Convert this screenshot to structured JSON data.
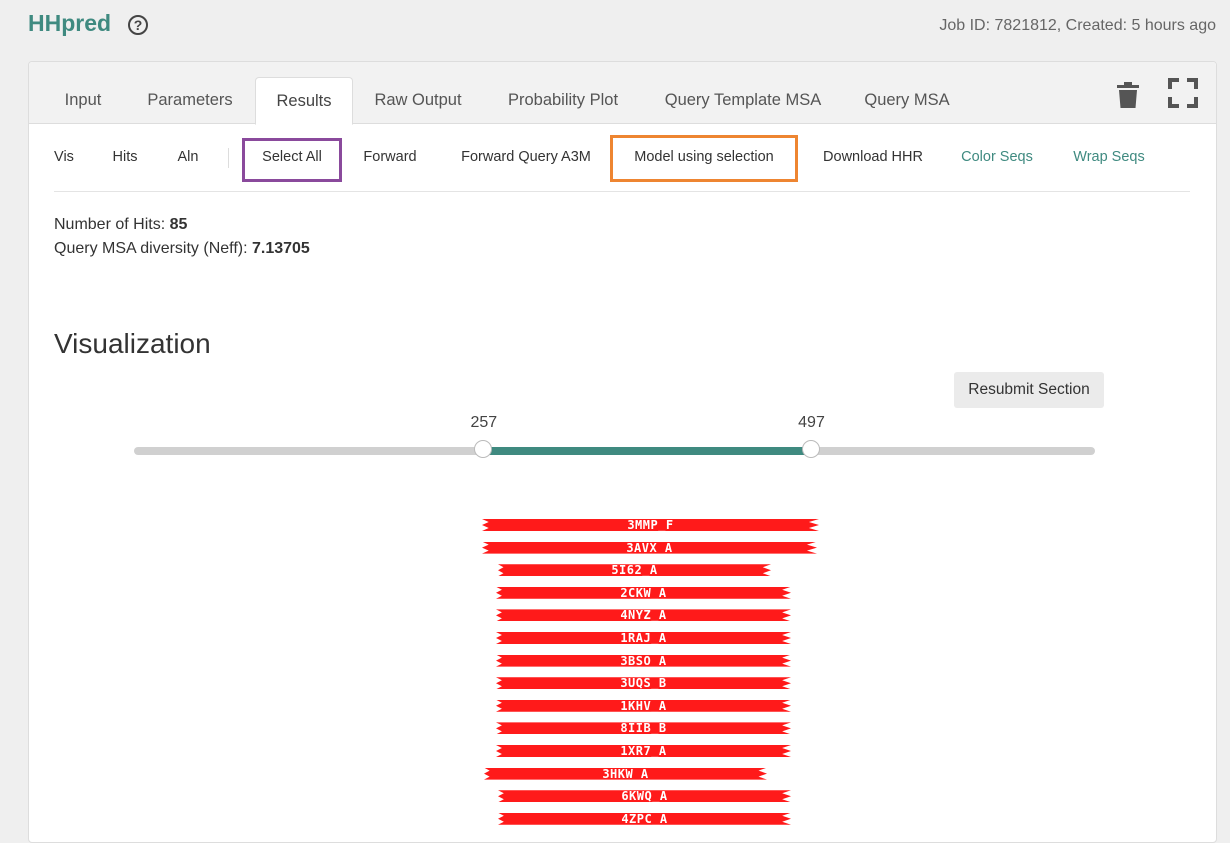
{
  "app": {
    "title": "HHpred",
    "job_info": "Job ID: 7821812,  Created: 5 hours ago"
  },
  "tabs": [
    {
      "label": "Input"
    },
    {
      "label": "Parameters"
    },
    {
      "label": "Results",
      "active": true
    },
    {
      "label": "Raw Output"
    },
    {
      "label": "Probability Plot"
    },
    {
      "label": "Query Template MSA"
    },
    {
      "label": "Query MSA"
    }
  ],
  "icons": {
    "help": "help-circle-icon",
    "trash": "trash-icon",
    "fullscreen": "fullscreen-icon"
  },
  "toolbar": {
    "vis": "Vis",
    "hits": "Hits",
    "aln": "Aln",
    "select_all": "Select All",
    "forward": "Forward",
    "forward_query": "Forward Query A3M",
    "model_selection": "Model using selection",
    "download": "Download HHR",
    "color_seqs": "Color Seqs",
    "wrap_seqs": "Wrap Seqs"
  },
  "stats": {
    "hits_label": "Number of Hits:",
    "hits_value": "85",
    "neff_label": "Query MSA diversity (Neff):",
    "neff_value": "7.13705"
  },
  "visualization": {
    "title": "Visualization",
    "resubmit": "Resubmit Section",
    "slider": {
      "min_label": "257",
      "max_label": "497",
      "range_start_fraction": 0.364,
      "range_end_fraction": 0.705
    },
    "hits": [
      "3MMP_F",
      "3AVX_A",
      "5I62_A",
      "2CKW_A",
      "4NYZ_A",
      "1RAJ_A",
      "3BSO_A",
      "3UQS_B",
      "1KHV_A",
      "8IIB_B",
      "1XR7_A",
      "3HKW_A",
      "6KWQ_A",
      "4ZPC_A"
    ]
  },
  "colors": {
    "accent": "#3f8a80",
    "hit_bar": "#ff1a1a",
    "highlight_select": "#8a4a9c",
    "highlight_model": "#ee8531"
  }
}
